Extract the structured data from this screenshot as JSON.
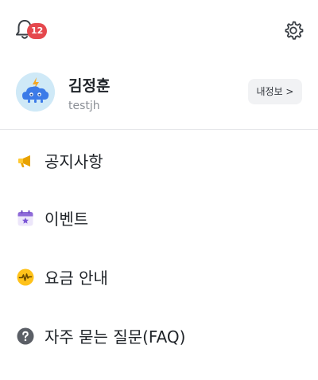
{
  "header": {
    "notification_count": "12",
    "bell_icon": "bell-icon",
    "settings_icon": "gear-icon"
  },
  "profile": {
    "name": "김정훈",
    "user_id": "testjh",
    "my_info_label": "내정보 >",
    "avatar_icon": "robot-cloud-avatar"
  },
  "menu": {
    "items": [
      {
        "label": "공지사항",
        "icon": "megaphone-icon"
      },
      {
        "label": "이벤트",
        "icon": "calendar-star-icon"
      },
      {
        "label": "요금 안내",
        "icon": "pulse-coin-icon"
      },
      {
        "label": "자주 묻는 질문(FAQ)",
        "icon": "question-circle-icon"
      }
    ]
  },
  "colors": {
    "badge": "#e5484d",
    "avatar_bg": "#cfe9f7",
    "button_bg": "#f1f2f4",
    "divider": "#e6e7ea"
  }
}
